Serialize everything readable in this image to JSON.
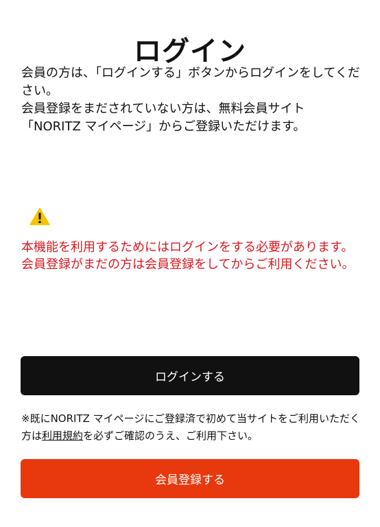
{
  "header": {
    "title": "ログイン"
  },
  "intro": {
    "line1": "会員の方は、「ログインする」ボタンからログインをしてください。",
    "line2": "会員登録をまだされていない方は、無料会員サイト「NORITZ マイページ」からご登録いただけます。"
  },
  "warning": {
    "icon": "warning-icon",
    "icon_color": "#f5c400",
    "text": "本機能を利用するためにはログインをする必要があります。会員登録がまだの方は会員登録をしてからご利用ください。",
    "color": "#d6191f"
  },
  "login": {
    "label": "ログインする",
    "color": "#111111"
  },
  "note": {
    "before": "※既にNORITZ マイページにご登録済で初めて当サイトをご利用いただく方は",
    "link": "利用規約",
    "after": "を必ずご確認のうえ、ご利用下さい。"
  },
  "register": {
    "label": "会員登録する",
    "color": "#e8380d"
  }
}
